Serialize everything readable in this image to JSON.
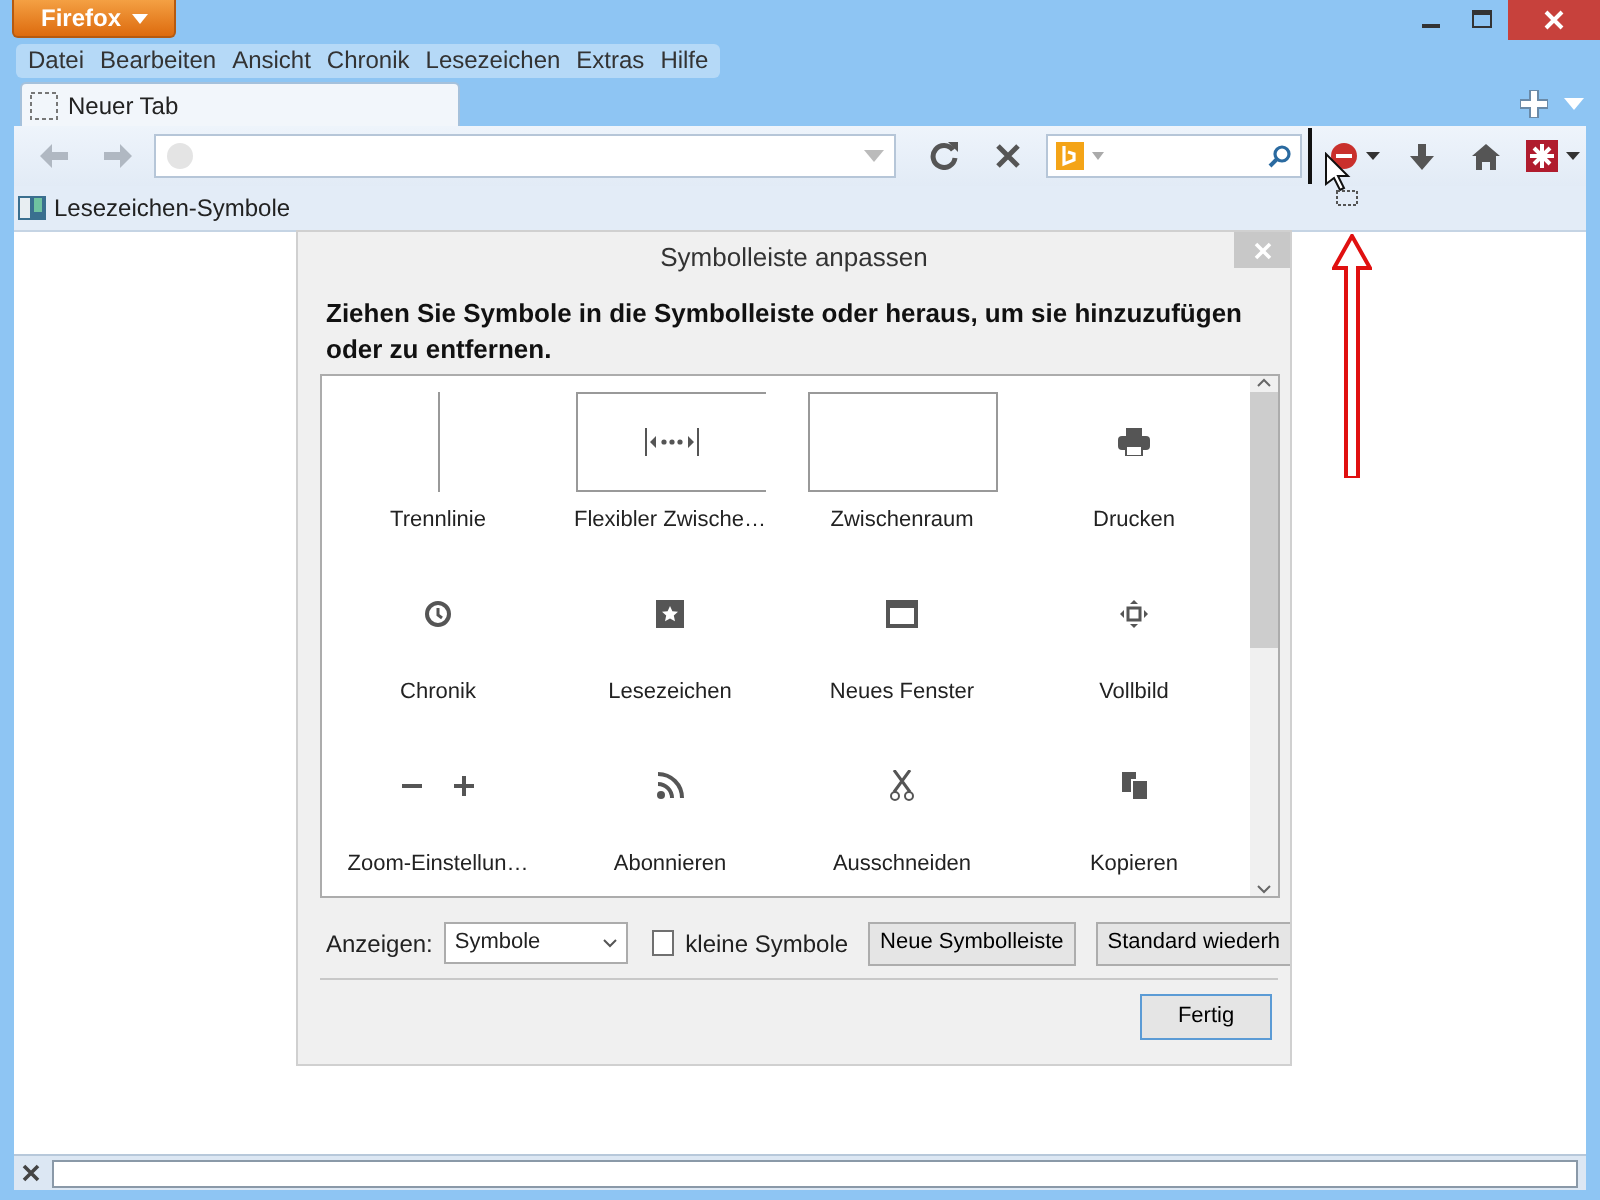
{
  "window": {
    "app_button": "Firefox"
  },
  "menu": [
    "Datei",
    "Bearbeiten",
    "Ansicht",
    "Chronik",
    "Lesezeichen",
    "Extras",
    "Hilfe"
  ],
  "tabs": [
    {
      "label": "Neuer Tab",
      "selected": true
    }
  ],
  "bookmarks_bar": [
    "Lesezeichen-Symbole"
  ],
  "dialog": {
    "title": "Symbolleiste anpassen",
    "instruction": "Ziehen Sie Symbole in die Symbolleiste oder heraus, um sie hinzuzufügen oder zu entfernen.",
    "items": [
      {
        "label": "Trennlinie",
        "kind": "separator"
      },
      {
        "label": "Flexibler Zwische…",
        "kind": "flexspace"
      },
      {
        "label": "Zwischenraum",
        "kind": "space"
      },
      {
        "label": "Drucken",
        "kind": "button"
      },
      {
        "label": "Chronik",
        "kind": "button"
      },
      {
        "label": "Lesezeichen",
        "kind": "button"
      },
      {
        "label": "Neues Fenster",
        "kind": "button"
      },
      {
        "label": "Vollbild",
        "kind": "button"
      },
      {
        "label": "Zoom-Einstellun…",
        "kind": "button"
      },
      {
        "label": "Abonnieren",
        "kind": "button"
      },
      {
        "label": "Ausschneiden",
        "kind": "button"
      },
      {
        "label": "Kopieren",
        "kind": "button"
      }
    ],
    "show_label": "Anzeigen:",
    "show_value": "Symbole",
    "small_icons": {
      "label": "kleine Symbole",
      "checked": false
    },
    "buttons": [
      "Neue Symbolleiste",
      "Standard wiederh"
    ],
    "done": "Fertig"
  }
}
